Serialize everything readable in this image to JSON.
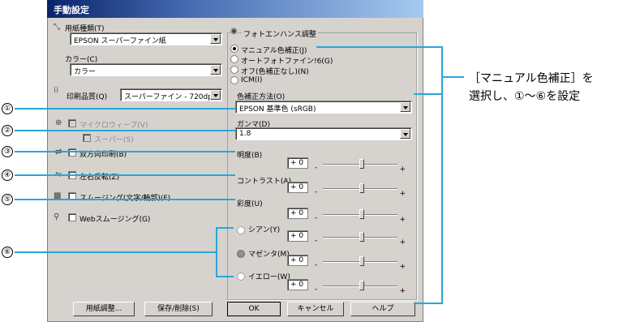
{
  "window": {
    "title": "手動設定"
  },
  "left": {
    "paper_type_label": "用紙種類(T)",
    "paper_type_value": "EPSON スーパーファイン紙",
    "color_label": "カラー(C)",
    "color_value": "カラー",
    "quality_label": "印刷品質(Q)",
    "quality_value": "スーパーファイン - 720dpi",
    "microweave_label": "マイクロウィーブ(V)",
    "super_label": "スーパー(S)",
    "bidirectional_label": "双方向印刷(B)",
    "flip_label": "左右反転(Z)",
    "smoothing_label": "スムージング(文字/輪郭)(F)",
    "web_smoothing_label": "Webスムージング(G)"
  },
  "right": {
    "group_title": "フォトエンハンス調整",
    "radio_manual": "マニュアル色補正(J)",
    "radio_auto": "オートフォトファイン!6(G)",
    "radio_off": "オフ(色補正なし)(N)",
    "radio_icm": "ICM(I)",
    "method_label": "色補正方法(O)",
    "method_value": "EPSON 基準色 (sRGB)",
    "gamma_label": "ガンマ(D)",
    "gamma_value": "1.8",
    "brightness_label": "明度(B)",
    "contrast_label": "コントラスト(A)",
    "saturation_label": "彩度(U)",
    "cyan_label": "シアン(Y)",
    "magenta_label": "マゼンタ(M)",
    "yellow_label": "イエロー(W)",
    "value_zero": "+ 0",
    "minus": "-",
    "plus": "+"
  },
  "buttons": {
    "paper_adjust": "用紙調整...",
    "save_delete": "保存/削除(S)",
    "ok": "OK",
    "cancel": "キャンセル",
    "help": "ヘルプ"
  },
  "annotations": {
    "n1": "①",
    "n2": "②",
    "n3": "③",
    "n4": "④",
    "n5": "⑤",
    "n6": "⑥",
    "note_line1": "［マニュアル色補正］を",
    "note_line2": "選択し、①〜⑥を設定"
  },
  "colors": {
    "accent": "#28a7d8",
    "face": "#d6d3ce",
    "title": "#0a246a"
  },
  "icons": [
    "paper-icon",
    "quality-icon",
    "microweave-icon",
    "bidirectional-icon",
    "flip-icon",
    "smoothing-icon",
    "web-smoothing-icon",
    "photo-enhance-icon"
  ]
}
